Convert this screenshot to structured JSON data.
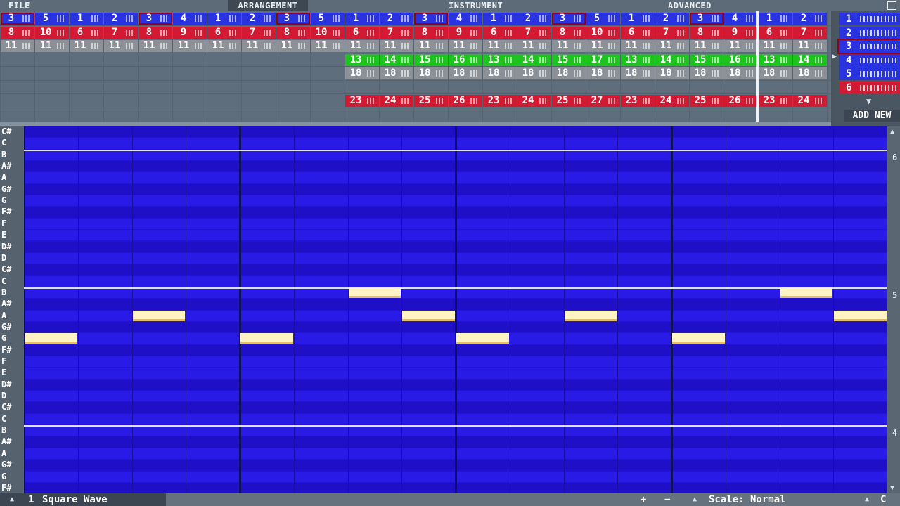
{
  "menu": {
    "file": "FILE",
    "arrangement": "ARRANGEMENT",
    "instrument": "INSTRUMENT",
    "advanced": "ADVANCED",
    "corner_icon": "window-icon"
  },
  "arrangement_rows": [
    {
      "color": "#2a33e0",
      "values": [
        "3",
        "5",
        "1",
        "2",
        "3",
        "4",
        "1",
        "2",
        "3",
        "5",
        "1",
        "2",
        "3",
        "4",
        "1",
        "2",
        "3",
        "5",
        "1",
        "2",
        "3",
        "4",
        "1",
        "2"
      ],
      "selected": [
        0,
        4,
        8,
        12,
        16,
        20
      ]
    },
    {
      "color": "#d21a33",
      "values": [
        "8",
        "10",
        "6",
        "7",
        "8",
        "9",
        "6",
        "7",
        "8",
        "10",
        "6",
        "7",
        "8",
        "9",
        "6",
        "7",
        "8",
        "10",
        "6",
        "7",
        "8",
        "9",
        "6",
        "7"
      ]
    },
    {
      "color": "#8b9197",
      "values": [
        "11",
        "11",
        "11",
        "11",
        "11",
        "11",
        "11",
        "11",
        "11",
        "11",
        "11",
        "11",
        "11",
        "11",
        "11",
        "11",
        "11",
        "11",
        "11",
        "11",
        "11",
        "11",
        "11",
        "11"
      ]
    },
    {
      "color": "#1ec41e",
      "values": [
        "",
        "",
        "",
        "",
        "",
        "",
        "",
        "",
        "",
        "",
        "13",
        "14",
        "15",
        "16",
        "13",
        "14",
        "15",
        "17",
        "13",
        "14",
        "15",
        "16",
        "13",
        "14"
      ]
    },
    {
      "color": "#8b9197",
      "values": [
        "",
        "",
        "",
        "",
        "",
        "",
        "",
        "",
        "",
        "",
        "18",
        "18",
        "18",
        "18",
        "18",
        "18",
        "18",
        "18",
        "18",
        "18",
        "18",
        "18",
        "18",
        "18"
      ]
    },
    {
      "color": "",
      "values": []
    },
    {
      "color": "#d21a33",
      "values": [
        "",
        "",
        "",
        "",
        "",
        "",
        "",
        "",
        "",
        "",
        "23",
        "24",
        "25",
        "26",
        "23",
        "24",
        "25",
        "27",
        "23",
        "24",
        "25",
        "26",
        "23",
        "24"
      ]
    }
  ],
  "channels": [
    {
      "num": "1",
      "color": "#2a33e0"
    },
    {
      "num": "2",
      "color": "#2a33e0"
    },
    {
      "num": "3",
      "color": "#2a33e0",
      "selected": true
    },
    {
      "num": "4",
      "color": "#2a33e0"
    },
    {
      "num": "5",
      "color": "#2a33e0"
    },
    {
      "num": "6",
      "color": "#d21a33"
    }
  ],
  "add_new": "ADD NEW",
  "keys": [
    "C#",
    "C",
    "B",
    "A#",
    "A",
    "G#",
    "G",
    "F#",
    "F",
    "E",
    "D#",
    "D",
    "C#",
    "C",
    "B",
    "A#",
    "A",
    "G#",
    "G",
    "F#",
    "F",
    "E",
    "D#",
    "D",
    "C#",
    "C",
    "B",
    "A#",
    "A",
    "G#",
    "G",
    "F#"
  ],
  "octave_labels": [
    {
      "label": "6",
      "row": 2
    },
    {
      "label": "5",
      "row": 14
    },
    {
      "label": "4",
      "row": 26
    }
  ],
  "notes": [
    {
      "key": "G",
      "row": 18,
      "step": 0
    },
    {
      "key": "A",
      "row": 16,
      "step": 2
    },
    {
      "key": "G",
      "row": 18,
      "step": 4
    },
    {
      "key": "B",
      "row": 14,
      "step": 6
    },
    {
      "key": "A",
      "row": 16,
      "step": 7
    },
    {
      "key": "G",
      "row": 18,
      "step": 8
    },
    {
      "key": "A",
      "row": 16,
      "step": 10
    },
    {
      "key": "G",
      "row": 18,
      "step": 12
    },
    {
      "key": "B",
      "row": 14,
      "step": 14
    },
    {
      "key": "A",
      "row": 16,
      "step": 15
    }
  ],
  "status": {
    "instrument_index": "1",
    "instrument_name": "Square Wave",
    "plus": "+",
    "minus": "−",
    "scale": "Scale: Normal",
    "key": "C"
  }
}
